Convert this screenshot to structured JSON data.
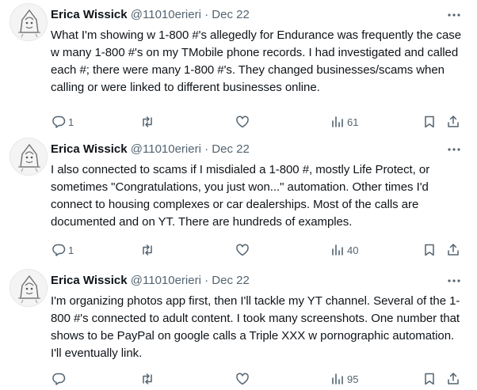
{
  "tweets": [
    {
      "author_name": "Erica Wissick",
      "author_handle": "@11010erieri",
      "separator": "·",
      "date": "Dec 22",
      "text": "What I'm showing w 1-800 #'s allegedly for Endurance was frequently the case w many 1-800 #'s on my TMobile phone records. I had investigated and called each #; there were many 1-800 #'s. They changed businesses/scams when calling or were linked to different businesses online.",
      "replies": "1",
      "retweets": "",
      "likes": "",
      "views": "61"
    },
    {
      "author_name": "Erica Wissick",
      "author_handle": "@11010erieri",
      "separator": "·",
      "date": "Dec 22",
      "text": "I also connected to scams if I misdialed a 1-800 #, mostly Life Protect, or sometimes \"Congratulations, you just won...\" automation. Other times I'd connect to housing complexes or car dealerships. Most of the calls are documented and on YT. There are hundreds of examples.",
      "replies": "1",
      "retweets": "",
      "likes": "",
      "views": "40"
    },
    {
      "author_name": "Erica Wissick",
      "author_handle": "@11010erieri",
      "separator": "·",
      "date": "Dec 22",
      "text": "I'm organizing photos app first, then I'll tackle my YT channel. Several of the 1-800 #'s connected to adult content. I took many screenshots. One number that shows to be PayPal on google calls a Triple XXX w pornographic automation. I'll eventually link.",
      "replies": "",
      "retweets": "",
      "likes": "",
      "views": "95"
    }
  ],
  "icons": {
    "avatar": "avatar-sketch-icon",
    "more": "more-dots-icon",
    "reply": "reply-icon",
    "retweet": "retweet-icon",
    "like": "like-heart-icon",
    "views": "views-bar-chart-icon",
    "bookmark": "bookmark-icon",
    "share": "share-icon"
  },
  "colors": {
    "text": "#0f1419",
    "secondary": "#536471",
    "background": "#ffffff"
  }
}
